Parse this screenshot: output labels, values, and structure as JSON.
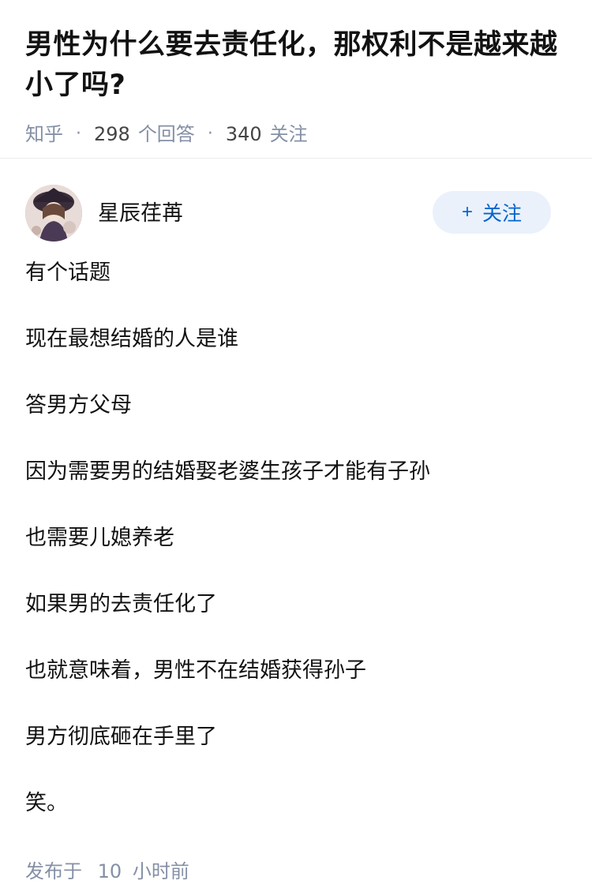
{
  "question": {
    "title": "男性为什么要去责任化，那权利不是越来越小了吗?",
    "source": "知乎",
    "answer_count": "298",
    "answer_label": "个回答",
    "follow_count": "340",
    "follow_label": "关注",
    "separator": "·"
  },
  "answer": {
    "author_name": "星辰荏苒",
    "follow_button_plus": "+",
    "follow_button_label": "关注",
    "paragraphs": [
      "有个话题",
      "现在最想结婚的人是谁",
      "答男方父母",
      "因为需要男的结婚娶老婆生孩子才能有子孙",
      "也需要儿媳养老",
      "如果男的去责任化了",
      "也就意味着，男性不在结婚获得孙子",
      "男方彻底砸在手里了",
      "笑。"
    ],
    "published_prefix": "发布于",
    "published_num": "10",
    "published_suffix": "小时前"
  }
}
